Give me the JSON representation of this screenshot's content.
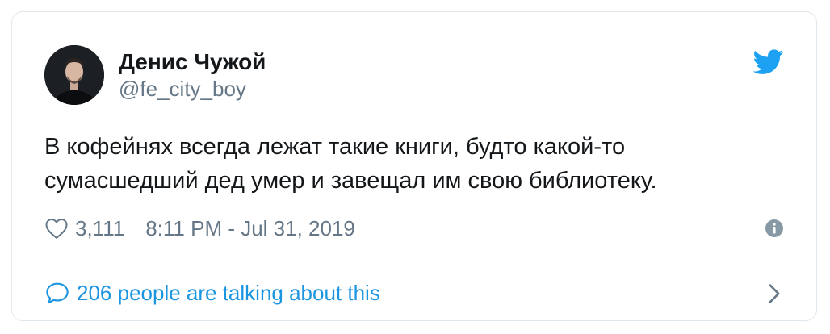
{
  "tweet": {
    "author": {
      "display_name": "Денис Чужой",
      "handle": "@fe_city_boy"
    },
    "text": "В кофейнях всегда лежат такие книги, будто какой-то сумасшедший дед умер и завещал им свою библиотеку.",
    "likes": "3,111",
    "timestamp": "8:11 PM - Jul 31, 2019",
    "footer_text": "206 people are talking about this"
  },
  "icons": {
    "brand": "twitter-bird-icon",
    "like": "heart-icon",
    "info": "info-icon",
    "conversation": "speech-bubble-icon",
    "chevron": "chevron-right-icon"
  },
  "colors": {
    "brand_blue": "#1da1f2",
    "link_blue": "#1b95e0",
    "muted_gray": "#657786",
    "border": "#e1e8ed",
    "text": "#14171a"
  }
}
